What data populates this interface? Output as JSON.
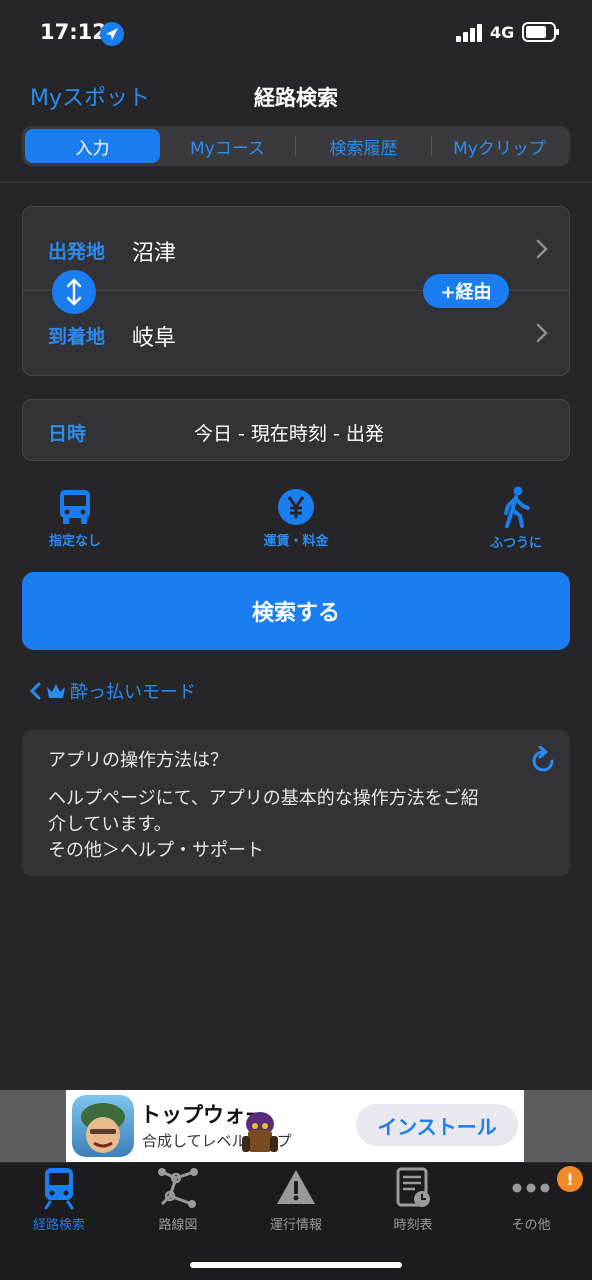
{
  "status_bar": {
    "time": "17:12",
    "network": "4G"
  },
  "header": {
    "left_link": "Myスポット",
    "title": "経路検索"
  },
  "tabs": [
    {
      "label": "入力",
      "active": true
    },
    {
      "label": "Myコース",
      "active": false
    },
    {
      "label": "検索履歴",
      "active": false
    },
    {
      "label": "Myクリップ",
      "active": false
    }
  ],
  "route": {
    "from_label": "出発地",
    "from_value": "沼津",
    "to_label": "到着地",
    "to_value": "岐阜",
    "via_button": "+経由"
  },
  "datetime": {
    "label": "日時",
    "value": "今日 - 現在時刻 - 出発"
  },
  "options": [
    {
      "label": "指定なし",
      "icon": "bus-icon"
    },
    {
      "label": "運賃・料金",
      "icon": "yen-icon"
    },
    {
      "label": "ふつうに",
      "icon": "walk-icon"
    }
  ],
  "search_button": "検索する",
  "drunk_mode": "酔っ払いモード",
  "help": {
    "title": "アプリの操作方法は？",
    "body_line1": "ヘルプページにて、アプリの基本的な操作方法をご紹",
    "body_line2": "介しています。",
    "body_line3": "その他＞ヘルプ・サポート"
  },
  "ad": {
    "title": "トップウォー",
    "subtitle": "合成してレベルアップ",
    "install": "インストール"
  },
  "tabbar": [
    {
      "label": "経路検索",
      "icon": "train-icon",
      "active": true
    },
    {
      "label": "路線図",
      "icon": "route-map-icon",
      "active": false
    },
    {
      "label": "運行情報",
      "icon": "warning-icon",
      "active": false
    },
    {
      "label": "時刻表",
      "icon": "timetable-icon",
      "active": false
    },
    {
      "label": "その他",
      "icon": "more-icon",
      "active": false
    }
  ],
  "badge": "!",
  "colors": {
    "accent": "#1a7df0",
    "background": "#262628",
    "card": "#333337",
    "badge": "#f08a24"
  }
}
